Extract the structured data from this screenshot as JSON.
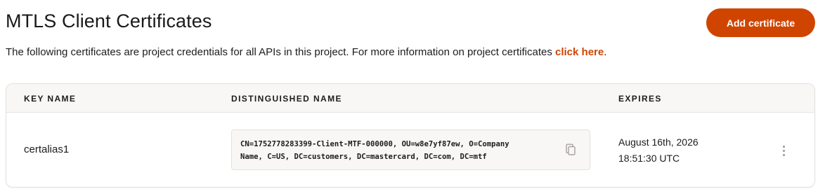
{
  "header": {
    "title": "MTLS Client Certificates",
    "add_button_label": "Add certificate",
    "description_prefix": "The following certificates are project credentials for all APIs in this project. For more information on project certificates ",
    "description_link": "click here",
    "description_suffix": "."
  },
  "table": {
    "columns": [
      "KEY NAME",
      "DISTINGUISHED NAME",
      "EXPIRES"
    ],
    "rows": [
      {
        "key_name": "certalias1",
        "distinguished_name": "CN=1752778283399-Client-MTF-000000, OU=w8e7yf87ew, O=Company\nName, C=US, DC=customers, DC=mastercard, DC=com, DC=mtf",
        "expires_date": "August 16th, 2026",
        "expires_time": "18:51:30 UTC"
      }
    ]
  },
  "icons": {
    "copy": "copy-icon",
    "row_menu": "more-vertical-icon"
  },
  "colors": {
    "accent": "#cf4500",
    "header_bg": "#f8f7f5",
    "border": "#e3e1dd"
  }
}
